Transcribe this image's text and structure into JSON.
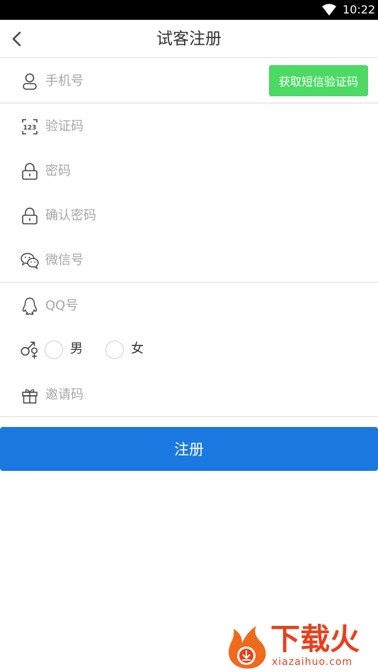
{
  "status_bar": {
    "time": "10:22",
    "wifi_icon": "wifi-icon"
  },
  "header": {
    "title": "试客注册",
    "back_icon": "back-arrow-icon"
  },
  "form": {
    "phone": {
      "placeholder": "手机号",
      "icon": "user-icon",
      "sms_button_label": "获取短信验证码"
    },
    "code": {
      "placeholder": "验证码",
      "icon": "code-123-icon"
    },
    "password": {
      "placeholder": "密码",
      "icon": "lock-icon"
    },
    "confirm_password": {
      "placeholder": "确认密码",
      "icon": "lock-icon"
    },
    "wechat": {
      "placeholder": "微信号",
      "icon": "wechat-icon"
    },
    "qq": {
      "placeholder": "QQ号",
      "icon": "qq-icon"
    },
    "gender": {
      "icon": "gender-icon",
      "options": [
        "男",
        "女"
      ]
    },
    "invite": {
      "placeholder": "邀请码",
      "icon": "gift-icon"
    }
  },
  "submit": {
    "label": "注册"
  },
  "watermark": {
    "brand": "下载火",
    "url": "xiazaihuo.com"
  },
  "colors": {
    "sms_button": "#4cd964",
    "submit_button": "#1a78e0",
    "watermark": "#e8401c"
  }
}
